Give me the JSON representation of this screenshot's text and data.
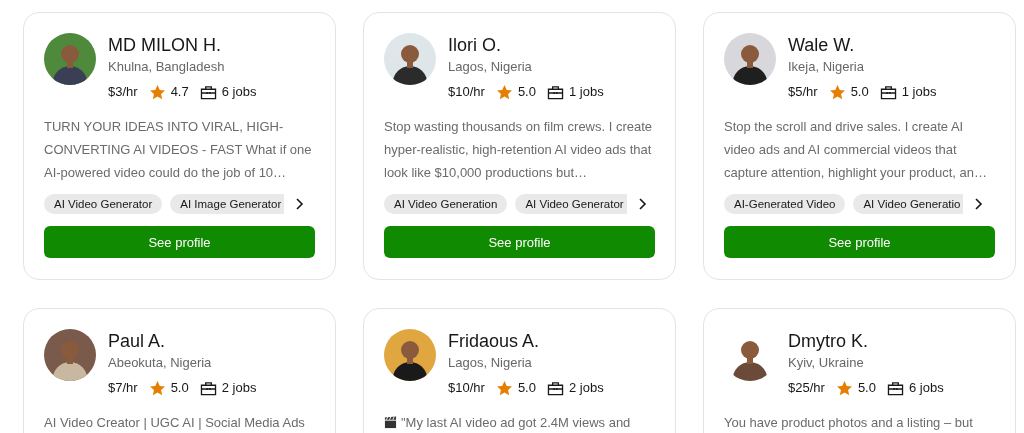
{
  "freelancers": [
    {
      "name": "MD MILON H.",
      "location": "Khulna, Bangladesh",
      "rate": "$3/hr",
      "rating": "4.7",
      "jobs": "6 jobs",
      "description": "TURN YOUR IDEAS INTO VIRAL, HIGH-CONVERTING AI VIDEOS - FAST What if one AI-powered video could do the job of 10…",
      "skills": [
        {
          "label": "AI Video Generator",
          "clipped": false
        },
        {
          "label": "AI Image Generator",
          "clipped": true
        }
      ],
      "button": "See profile"
    },
    {
      "name": "Ilori O.",
      "location": "Lagos, Nigeria",
      "rate": "$10/hr",
      "rating": "5.0",
      "jobs": "1 jobs",
      "description": "Stop wasting thousands on film crews. I create hyper-realistic, high-retention AI video ads that look like $10,000 productions but…",
      "skills": [
        {
          "label": "AI Video Generation",
          "clipped": false
        },
        {
          "label": "AI Video Generator",
          "clipped": true
        }
      ],
      "button": "See profile"
    },
    {
      "name": "Wale W.",
      "location": "Ikeja, Nigeria",
      "rate": "$5/hr",
      "rating": "5.0",
      "jobs": "1 jobs",
      "description": "Stop the scroll and drive sales. I create AI video ads and AI commercial videos that capture attention, highlight your product, an…",
      "skills": [
        {
          "label": "AI-Generated Video",
          "clipped": false
        },
        {
          "label": "AI Video Generatio",
          "clipped": true
        }
      ],
      "button": "See profile"
    },
    {
      "name": "Paul A.",
      "location": "Abeokuta, Nigeria",
      "rate": "$7/hr",
      "rating": "5.0",
      "jobs": "2 jobs",
      "description": "AI Video Creator | UGC AI | Social Media Ads"
    },
    {
      "name": "Fridaous A.",
      "location": "Lagos, Nigeria",
      "rate": "$10/hr",
      "rating": "5.0",
      "jobs": "2 jobs",
      "kind": "icon_text",
      "description": "\"My last AI video ad got 2.4M views and"
    },
    {
      "name": "Dmytro K.",
      "location": "Kyiv, Ukraine",
      "rate": "$25/hr",
      "rating": "5.0",
      "jobs": "6 jobs",
      "description": "You have product photos and a listing – but"
    }
  ]
}
